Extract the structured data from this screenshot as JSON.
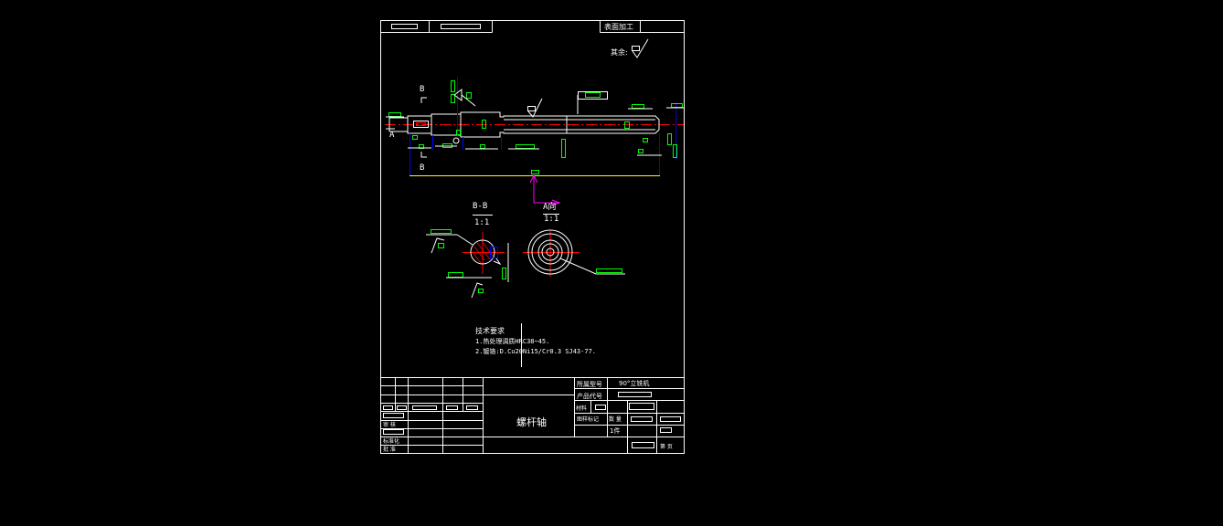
{
  "title_block": {
    "top_right_label": "表面加工",
    "part_name": "螺杆轴",
    "field_model_label": "所属型号",
    "field_model_value": "90°立铣机",
    "field_product_code_label": "产品代号",
    "field_material_label": "材料",
    "field_weight_label": "图样标记",
    "field_qty_label": "数 量",
    "field_pieces": "1件",
    "field_sheet": "第  页",
    "left_labels": [
      "审  核",
      "标准化",
      "批  准"
    ]
  },
  "annotations": {
    "surface_rest": "其余:",
    "section_b_top": "B",
    "section_b_bottom": "B",
    "view_a": "A",
    "section_bb_title": "B-B",
    "section_bb_scale": "1:1",
    "view_a_title": "A向",
    "view_a_scale": "1:1"
  },
  "tech_notes": {
    "heading": "技术要求",
    "line1": "1.热处理调质HRC38~45.",
    "line2": "2.镀铬:D.Cu20Ni15/Cr0.3 SJ43-77."
  },
  "colors": {
    "line": "#ffffff",
    "dimension": "#00ff00",
    "center": "#ff0000",
    "hidden": "#0000ff",
    "extension": "#ffff00",
    "view_arrow": "#ff00ff"
  }
}
